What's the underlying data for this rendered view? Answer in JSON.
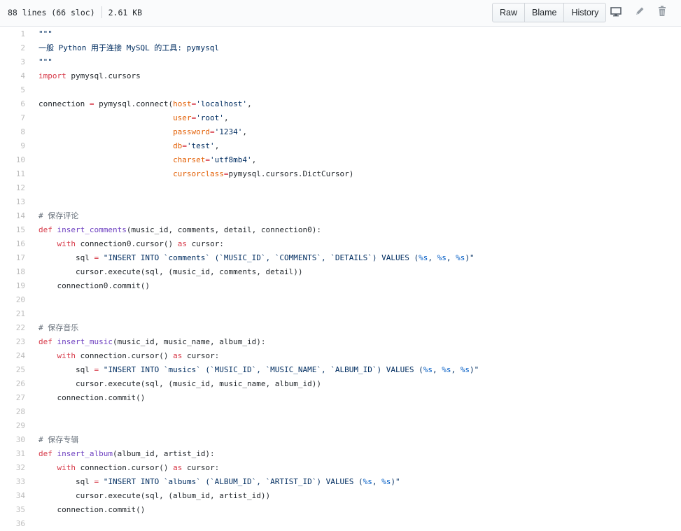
{
  "file_info": {
    "lines": "88 lines (66 sloc)",
    "size": "2.61 KB"
  },
  "toolbar": {
    "raw_label": "Raw",
    "blame_label": "Blame",
    "history_label": "History",
    "icons": [
      "desktop-icon",
      "pencil-icon",
      "trash-icon"
    ]
  },
  "code": {
    "language": "python",
    "lines": [
      {
        "n": "1",
        "tokens": [
          {
            "t": "\"\"\"",
            "c": "s"
          }
        ]
      },
      {
        "n": "2",
        "tokens": [
          {
            "t": "一般 Python 用于连接 MySQL 的工具: pymysql",
            "c": "s"
          }
        ]
      },
      {
        "n": "3",
        "tokens": [
          {
            "t": "\"\"\"",
            "c": "s"
          }
        ]
      },
      {
        "n": "4",
        "tokens": [
          {
            "t": "import",
            "c": "k"
          },
          {
            "t": " pymysql.cursors",
            "c": ""
          }
        ]
      },
      {
        "n": "5",
        "tokens": []
      },
      {
        "n": "6",
        "tokens": [
          {
            "t": "connection ",
            "c": ""
          },
          {
            "t": "=",
            "c": "k"
          },
          {
            "t": " pymysql.connect(",
            "c": ""
          },
          {
            "t": "host",
            "c": "p"
          },
          {
            "t": "=",
            "c": "k"
          },
          {
            "t": "'localhost'",
            "c": "s"
          },
          {
            "t": ",",
            "c": ""
          }
        ]
      },
      {
        "n": "7",
        "tokens": [
          {
            "t": "                             ",
            "c": ""
          },
          {
            "t": "user",
            "c": "p"
          },
          {
            "t": "=",
            "c": "k"
          },
          {
            "t": "'root'",
            "c": "s"
          },
          {
            "t": ",",
            "c": ""
          }
        ]
      },
      {
        "n": "8",
        "tokens": [
          {
            "t": "                             ",
            "c": ""
          },
          {
            "t": "password",
            "c": "p"
          },
          {
            "t": "=",
            "c": "k"
          },
          {
            "t": "'1234'",
            "c": "s"
          },
          {
            "t": ",",
            "c": ""
          }
        ]
      },
      {
        "n": "9",
        "tokens": [
          {
            "t": "                             ",
            "c": ""
          },
          {
            "t": "db",
            "c": "p"
          },
          {
            "t": "=",
            "c": "k"
          },
          {
            "t": "'test'",
            "c": "s"
          },
          {
            "t": ",",
            "c": ""
          }
        ]
      },
      {
        "n": "10",
        "tokens": [
          {
            "t": "                             ",
            "c": ""
          },
          {
            "t": "charset",
            "c": "p"
          },
          {
            "t": "=",
            "c": "k"
          },
          {
            "t": "'utf8mb4'",
            "c": "s"
          },
          {
            "t": ",",
            "c": ""
          }
        ]
      },
      {
        "n": "11",
        "tokens": [
          {
            "t": "                             ",
            "c": ""
          },
          {
            "t": "cursorclass",
            "c": "p"
          },
          {
            "t": "=",
            "c": "k"
          },
          {
            "t": "pymysql.cursors.DictCursor)",
            "c": ""
          }
        ]
      },
      {
        "n": "12",
        "tokens": []
      },
      {
        "n": "13",
        "tokens": []
      },
      {
        "n": "14",
        "tokens": [
          {
            "t": "# 保存评论",
            "c": "c"
          }
        ]
      },
      {
        "n": "15",
        "tokens": [
          {
            "t": "def",
            "c": "k"
          },
          {
            "t": " ",
            "c": ""
          },
          {
            "t": "insert_comments",
            "c": "f"
          },
          {
            "t": "(music_id, comments, detail, connection0):",
            "c": ""
          }
        ]
      },
      {
        "n": "16",
        "tokens": [
          {
            "t": "    ",
            "c": ""
          },
          {
            "t": "with",
            "c": "k"
          },
          {
            "t": " connection0.cursor() ",
            "c": ""
          },
          {
            "t": "as",
            "c": "k"
          },
          {
            "t": " cursor:",
            "c": ""
          }
        ]
      },
      {
        "n": "17",
        "tokens": [
          {
            "t": "        sql ",
            "c": ""
          },
          {
            "t": "=",
            "c": "k"
          },
          {
            "t": " ",
            "c": ""
          },
          {
            "t": "\"INSERT INTO `comments` (`MUSIC_ID`, `COMMENTS`, `DETAILS`) VALUES (",
            "c": "s"
          },
          {
            "t": "%s",
            "c": "n"
          },
          {
            "t": ", ",
            "c": "s"
          },
          {
            "t": "%s",
            "c": "n"
          },
          {
            "t": ", ",
            "c": "s"
          },
          {
            "t": "%s",
            "c": "n"
          },
          {
            "t": ")\"",
            "c": "s"
          }
        ]
      },
      {
        "n": "18",
        "tokens": [
          {
            "t": "        cursor.execute(sql, (music_id, comments, detail))",
            "c": ""
          }
        ]
      },
      {
        "n": "19",
        "tokens": [
          {
            "t": "    connection0.commit()",
            "c": ""
          }
        ]
      },
      {
        "n": "20",
        "tokens": []
      },
      {
        "n": "21",
        "tokens": []
      },
      {
        "n": "22",
        "tokens": [
          {
            "t": "# 保存音乐",
            "c": "c"
          }
        ]
      },
      {
        "n": "23",
        "tokens": [
          {
            "t": "def",
            "c": "k"
          },
          {
            "t": " ",
            "c": ""
          },
          {
            "t": "insert_music",
            "c": "f"
          },
          {
            "t": "(music_id, music_name, album_id):",
            "c": ""
          }
        ]
      },
      {
        "n": "24",
        "tokens": [
          {
            "t": "    ",
            "c": ""
          },
          {
            "t": "with",
            "c": "k"
          },
          {
            "t": " connection.cursor() ",
            "c": ""
          },
          {
            "t": "as",
            "c": "k"
          },
          {
            "t": " cursor:",
            "c": ""
          }
        ]
      },
      {
        "n": "25",
        "tokens": [
          {
            "t": "        sql ",
            "c": ""
          },
          {
            "t": "=",
            "c": "k"
          },
          {
            "t": " ",
            "c": ""
          },
          {
            "t": "\"INSERT INTO `musics` (`MUSIC_ID`, `MUSIC_NAME`, `ALBUM_ID`) VALUES (",
            "c": "s"
          },
          {
            "t": "%s",
            "c": "n"
          },
          {
            "t": ", ",
            "c": "s"
          },
          {
            "t": "%s",
            "c": "n"
          },
          {
            "t": ", ",
            "c": "s"
          },
          {
            "t": "%s",
            "c": "n"
          },
          {
            "t": ")\"",
            "c": "s"
          }
        ]
      },
      {
        "n": "26",
        "tokens": [
          {
            "t": "        cursor.execute(sql, (music_id, music_name, album_id))",
            "c": ""
          }
        ]
      },
      {
        "n": "27",
        "tokens": [
          {
            "t": "    connection.commit()",
            "c": ""
          }
        ]
      },
      {
        "n": "28",
        "tokens": []
      },
      {
        "n": "29",
        "tokens": []
      },
      {
        "n": "30",
        "tokens": [
          {
            "t": "# 保存专辑",
            "c": "c"
          }
        ]
      },
      {
        "n": "31",
        "tokens": [
          {
            "t": "def",
            "c": "k"
          },
          {
            "t": " ",
            "c": ""
          },
          {
            "t": "insert_album",
            "c": "f"
          },
          {
            "t": "(album_id, artist_id):",
            "c": ""
          }
        ]
      },
      {
        "n": "32",
        "tokens": [
          {
            "t": "    ",
            "c": ""
          },
          {
            "t": "with",
            "c": "k"
          },
          {
            "t": " connection.cursor() ",
            "c": ""
          },
          {
            "t": "as",
            "c": "k"
          },
          {
            "t": " cursor:",
            "c": ""
          }
        ]
      },
      {
        "n": "33",
        "tokens": [
          {
            "t": "        sql ",
            "c": ""
          },
          {
            "t": "=",
            "c": "k"
          },
          {
            "t": " ",
            "c": ""
          },
          {
            "t": "\"INSERT INTO `albums` (`ALBUM_ID`, `ARTIST_ID`) VALUES (",
            "c": "s"
          },
          {
            "t": "%s",
            "c": "n"
          },
          {
            "t": ", ",
            "c": "s"
          },
          {
            "t": "%s",
            "c": "n"
          },
          {
            "t": ")\"",
            "c": "s"
          }
        ]
      },
      {
        "n": "34",
        "tokens": [
          {
            "t": "        cursor.execute(sql, (album_id, artist_id))",
            "c": ""
          }
        ]
      },
      {
        "n": "35",
        "tokens": [
          {
            "t": "    connection.commit()",
            "c": ""
          }
        ]
      },
      {
        "n": "36",
        "tokens": []
      }
    ]
  }
}
